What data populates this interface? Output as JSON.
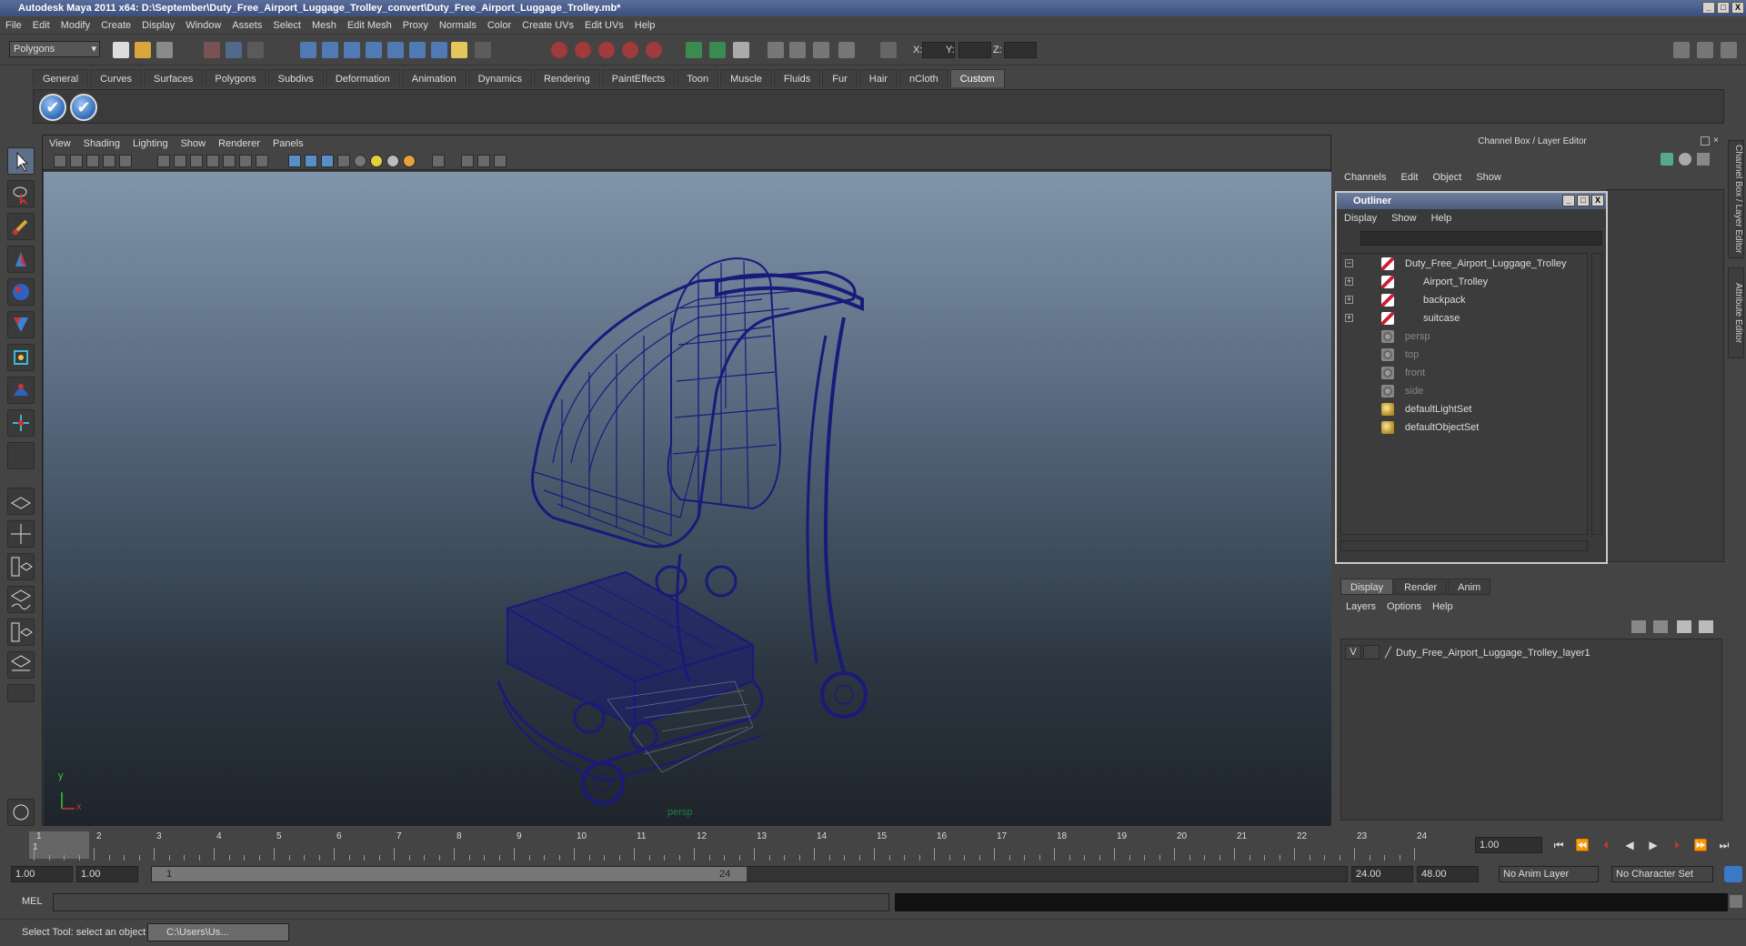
{
  "window": {
    "title": "Autodesk Maya 2011 x64: D:\\September\\Duty_Free_Airport_Luggage_Trolley_convert\\Duty_Free_Airport_Luggage_Trolley.mb*",
    "controls": [
      "_",
      "□",
      "X"
    ]
  },
  "menubar": [
    "File",
    "Edit",
    "Modify",
    "Create",
    "Display",
    "Window",
    "Assets",
    "Select",
    "Mesh",
    "Edit Mesh",
    "Proxy",
    "Normals",
    "Color",
    "Create UVs",
    "Edit UVs",
    "Help"
  ],
  "statusline": {
    "mode": "Polygons",
    "coord_labels": [
      "X:",
      "Y:",
      "Z:"
    ]
  },
  "shelf": {
    "tabs": [
      "General",
      "Curves",
      "Surfaces",
      "Polygons",
      "Subdivs",
      "Deformation",
      "Animation",
      "Dynamics",
      "Rendering",
      "PaintEffects",
      "Toon",
      "Muscle",
      "Fluids",
      "Fur",
      "Hair",
      "nCloth",
      "Custom"
    ],
    "active_tab": "Custom",
    "button_glyph": "✔"
  },
  "viewport": {
    "menu": [
      "View",
      "Shading",
      "Lighting",
      "Show",
      "Renderer",
      "Panels"
    ],
    "camera_label": "persp",
    "axis_x": "x",
    "axis_y": "y",
    "wire_color": "#1a1a7a"
  },
  "channel_box": {
    "title": "Channel Box / Layer Editor",
    "menu": [
      "Channels",
      "Edit",
      "Object",
      "Show"
    ]
  },
  "outliner": {
    "title": "Outliner",
    "controls": [
      "_",
      "□",
      "X"
    ],
    "menu": [
      "Display",
      "Show",
      "Help"
    ],
    "items": [
      {
        "label": "Duty_Free_Airport_Luggage_Trolley",
        "expand": "−",
        "icon": "transform-icon",
        "dim": false
      },
      {
        "label": "Airport_Trolley",
        "expand": "+",
        "icon": "transform-icon",
        "dim": false
      },
      {
        "label": "backpack",
        "expand": "+",
        "icon": "transform-icon",
        "dim": false
      },
      {
        "label": "suitcase",
        "expand": "+",
        "icon": "transform-icon",
        "dim": false
      },
      {
        "label": "persp",
        "expand": "",
        "icon": "camera-icon",
        "dim": true
      },
      {
        "label": "top",
        "expand": "",
        "icon": "camera-icon",
        "dim": true
      },
      {
        "label": "front",
        "expand": "",
        "icon": "camera-icon",
        "dim": true
      },
      {
        "label": "side",
        "expand": "",
        "icon": "camera-icon",
        "dim": true
      },
      {
        "label": "defaultLightSet",
        "expand": "",
        "icon": "set-icon",
        "dim": false
      },
      {
        "label": "defaultObjectSet",
        "expand": "",
        "icon": "set-icon",
        "dim": false
      }
    ]
  },
  "layer_editor": {
    "tabs": [
      "Display",
      "Render",
      "Anim"
    ],
    "active_tab": "Display",
    "menu": [
      "Layers",
      "Options",
      "Help"
    ],
    "layers": [
      {
        "visible": "V",
        "name": "Duty_Free_Airport_Luggage_Trolley_layer1"
      }
    ]
  },
  "side_tabs": [
    "Channel Box / Layer Editor",
    "Attribute Editor"
  ],
  "timeline": {
    "frames": [
      "1",
      "2",
      "3",
      "4",
      "5",
      "6",
      "7",
      "8",
      "9",
      "10",
      "11",
      "12",
      "13",
      "14",
      "15",
      "16",
      "17",
      "18",
      "19",
      "20",
      "21",
      "22",
      "23",
      "24"
    ],
    "current_frame": "1",
    "current_time_field": "1.00"
  },
  "range": {
    "start": "1.00",
    "playback_start": "1.00",
    "slider_start": "1",
    "slider_end": "24",
    "playback_end": "24.00",
    "end": "48.00",
    "anim_layer": "No Anim Layer",
    "character_set": "No Character Set"
  },
  "command": {
    "label": "MEL"
  },
  "helpline": {
    "text": "Select Tool: select an object",
    "task_window": "C:\\Users\\Us..."
  }
}
